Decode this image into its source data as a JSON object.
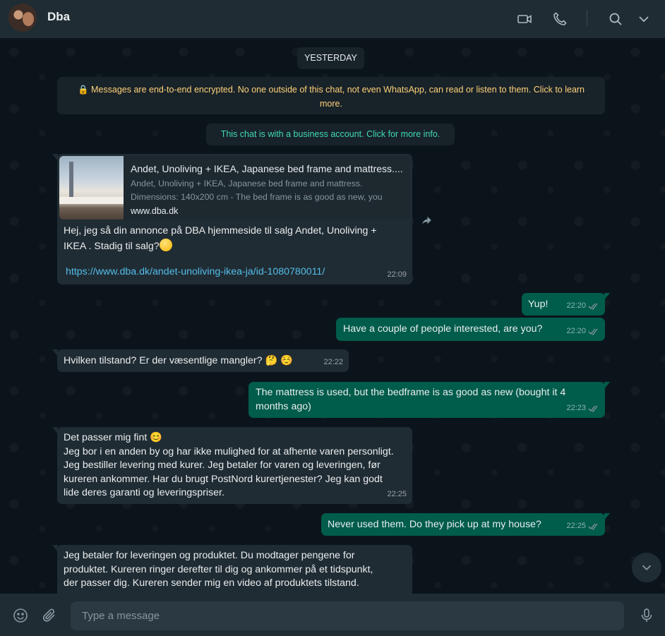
{
  "header": {
    "title": "Dba",
    "icons": [
      "video-call-icon",
      "voice-call-icon",
      "search-icon",
      "chevron-down-icon"
    ]
  },
  "chat": {
    "date_label": "YESTERDAY",
    "encryption_notice": "🔒 Messages are end-to-end encrypted. No one outside of this chat, not even WhatsApp, can read or listen to them. Click to learn more.",
    "business_notice": "This chat is with a business account. Click for more info.",
    "messages": [
      {
        "direction": "incoming",
        "link_preview": {
          "title": "Andet, Unoliving + IKEA, Japanese bed frame and mattress....",
          "description_line1": "Andet, Unoliving + IKEA, Japanese bed frame and mattress.",
          "description_line2": "Dimensions: 140x200 cm - The bed frame is as good as new, you",
          "domain": "www.dba.dk"
        },
        "text_line1": "Hej, jeg så din annonce på DBA hjemmeside til salg Andet, Unoliving +",
        "text_line2": "IKEA . Stadig til salg?",
        "link": "https://www.dba.dk/andet-unoliving-ikea-ja/id-1080780011/",
        "time": "22:09"
      },
      {
        "direction": "outgoing",
        "text": "Yup!",
        "time": "22:20"
      },
      {
        "direction": "outgoing",
        "text": "Have a couple of people interested, are you?",
        "time": "22:20"
      },
      {
        "direction": "incoming",
        "text": "Hvilken tilstand?  Er der væsentlige mangler? 🤔 ☺️",
        "time": "22:22"
      },
      {
        "direction": "outgoing",
        "text_line1": "The mattress is used, but the bedframe is as good as new (bought it 4",
        "text_line2": "months ago)",
        "time": "22:23"
      },
      {
        "direction": "incoming",
        "lines": [
          "Det passer mig fint 😊",
          "Jeg bor i en anden by og har ikke mulighed for at afhente varen personligt.",
          "Jeg bestiller levering med kurer.  Jeg betaler for varen og leveringen, før",
          "kureren ankommer.  Har du brugt PostNord kurertjenester?  Jeg kan godt",
          "lide deres garanti og leveringspriser."
        ],
        "time": "22:25"
      },
      {
        "direction": "outgoing",
        "text": "Never used them. Do they pick up at my house?",
        "time": "22:25"
      },
      {
        "direction": "incoming",
        "lines": [
          "Jeg betaler for leveringen og produktet.  Du modtager pengene for",
          "produktet.  Kureren ringer derefter til dig og ankommer på et tidspunkt,",
          "der passer dig.  Kureren sender mig en video af produktets tilstand."
        ]
      }
    ]
  },
  "composer": {
    "placeholder": "Type a message",
    "icons": [
      "emoji-icon",
      "attach-icon",
      "microphone-icon"
    ]
  },
  "colors": {
    "incoming_bubble": "#202c33",
    "outgoing_bubble": "#005c4b",
    "link": "#53bdeb",
    "encryption_text": "#ffd279",
    "business_text": "#40d9b5"
  }
}
